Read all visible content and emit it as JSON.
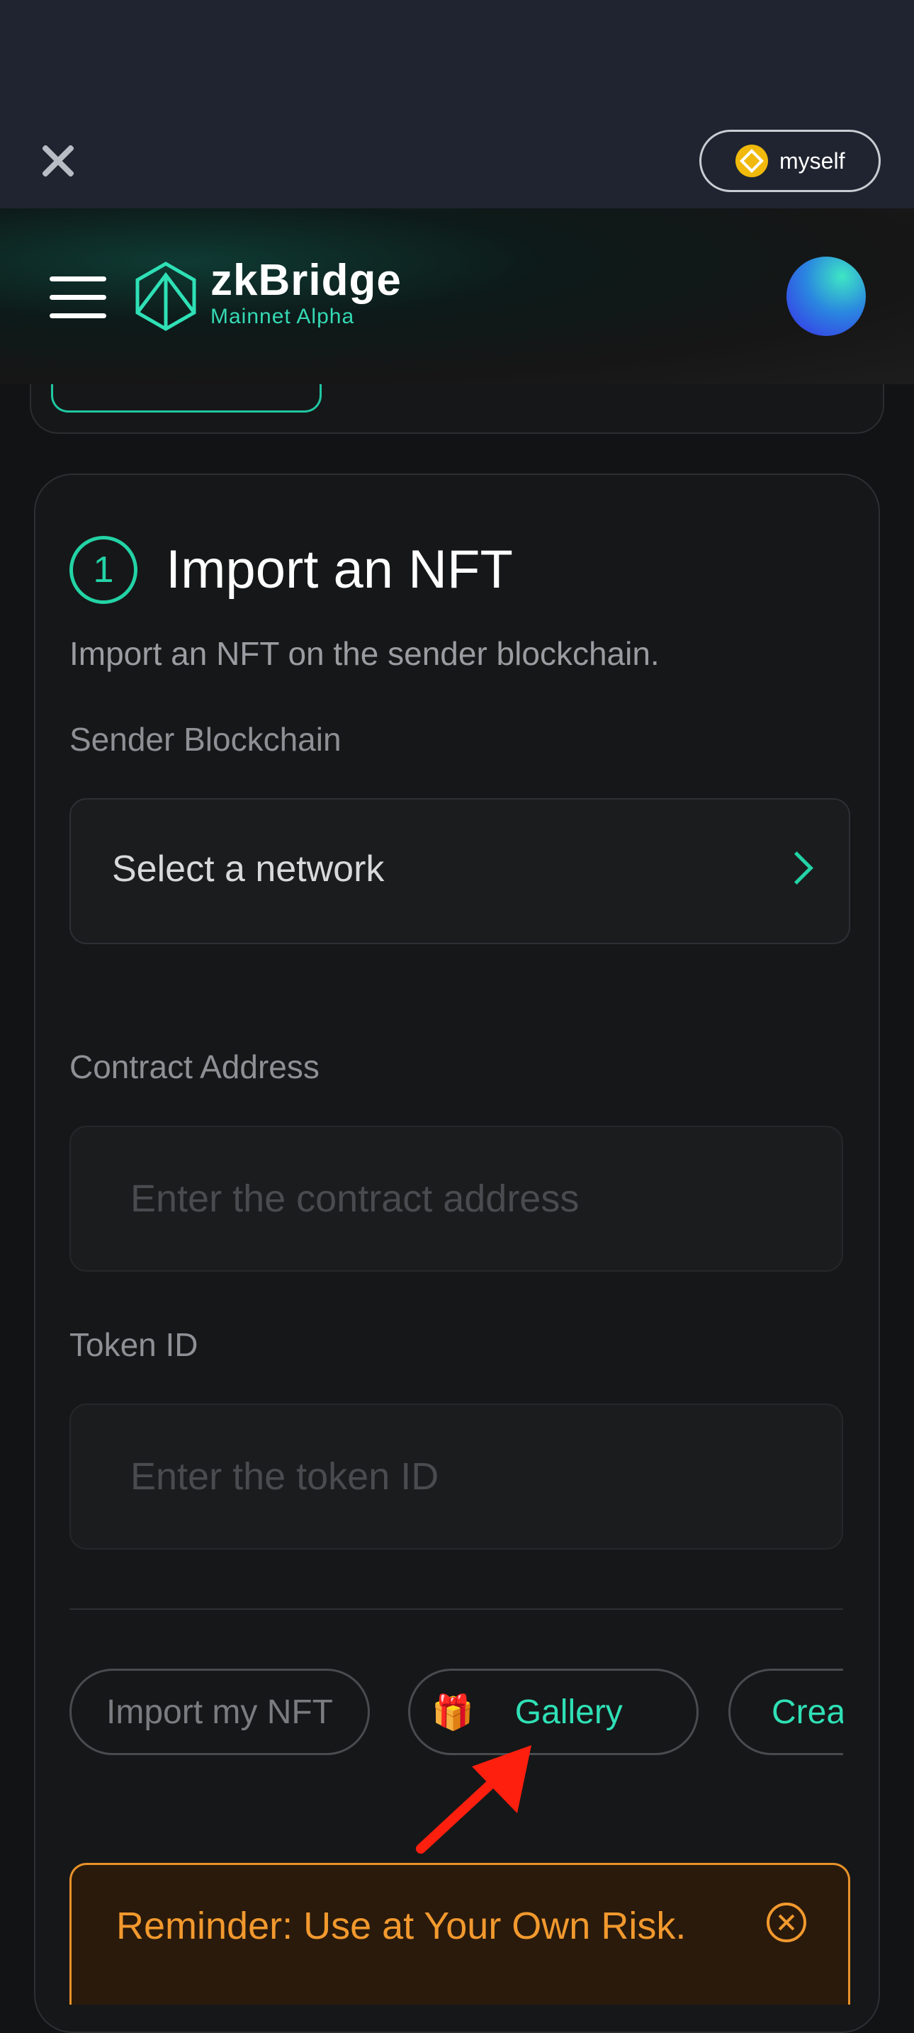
{
  "topbar": {
    "close_icon": "close-icon",
    "account_label": "myself",
    "account_icon": "bnb-coin-icon"
  },
  "header": {
    "menu_icon": "hamburger-menu-icon",
    "logo_icon": "zkbridge-logo-icon",
    "brand_name": "zkBridge",
    "brand_sub": "Mainnet Alpha",
    "avatar": "gradient-avatar"
  },
  "step": {
    "number": "1",
    "title": "Import an NFT",
    "description": "Import an NFT on the sender blockchain."
  },
  "form": {
    "sender_label": "Sender Blockchain",
    "network_select": "Select a network",
    "contract_label": "Contract Address",
    "contract_placeholder": "Enter the contract address",
    "token_label": "Token ID",
    "token_placeholder": "Enter the token ID"
  },
  "tabs": {
    "import": "Import my NFT",
    "gallery_icon": "🎁",
    "gallery": "Gallery",
    "create": "Crea"
  },
  "reminder": {
    "text": "Reminder: Use at Your Own Risk."
  },
  "colors": {
    "accent": "#23d3a6",
    "warning": "#f2992e",
    "annotation_arrow": "#ff1f0f"
  }
}
